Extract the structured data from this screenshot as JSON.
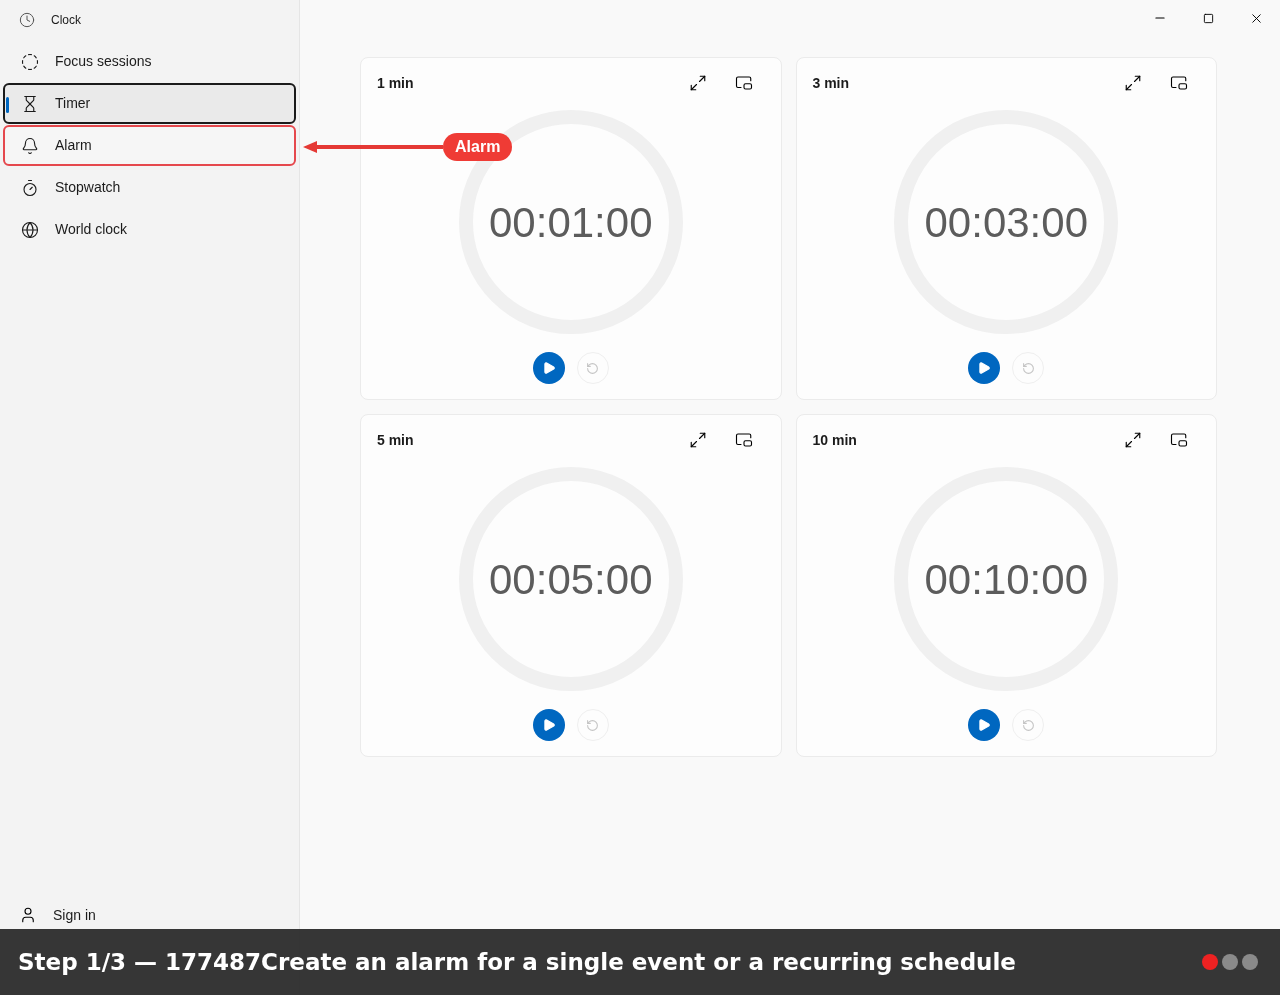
{
  "window": {
    "title": "Clock"
  },
  "sidebar": {
    "items": [
      {
        "label": "Focus sessions",
        "selected": false,
        "highlighted": false
      },
      {
        "label": "Timer",
        "selected": true,
        "highlighted": false
      },
      {
        "label": "Alarm",
        "selected": false,
        "highlighted": true
      },
      {
        "label": "Stopwatch",
        "selected": false,
        "highlighted": false
      },
      {
        "label": "World clock",
        "selected": false,
        "highlighted": false
      }
    ],
    "footer": {
      "label": "Sign in"
    }
  },
  "annotation": {
    "label": "Alarm"
  },
  "timers": [
    {
      "title": "1 min",
      "time": "00:01:00"
    },
    {
      "title": "3 min",
      "time": "00:03:00"
    },
    {
      "title": "5 min",
      "time": "00:05:00"
    },
    {
      "title": "10 min",
      "time": "00:10:00"
    }
  ],
  "caption": {
    "text": "Step 1/3 — 177487Create an alarm for a single event or a recurring schedule",
    "steps": [
      {
        "selected": true
      },
      {
        "selected": false
      },
      {
        "selected": false
      }
    ]
  }
}
